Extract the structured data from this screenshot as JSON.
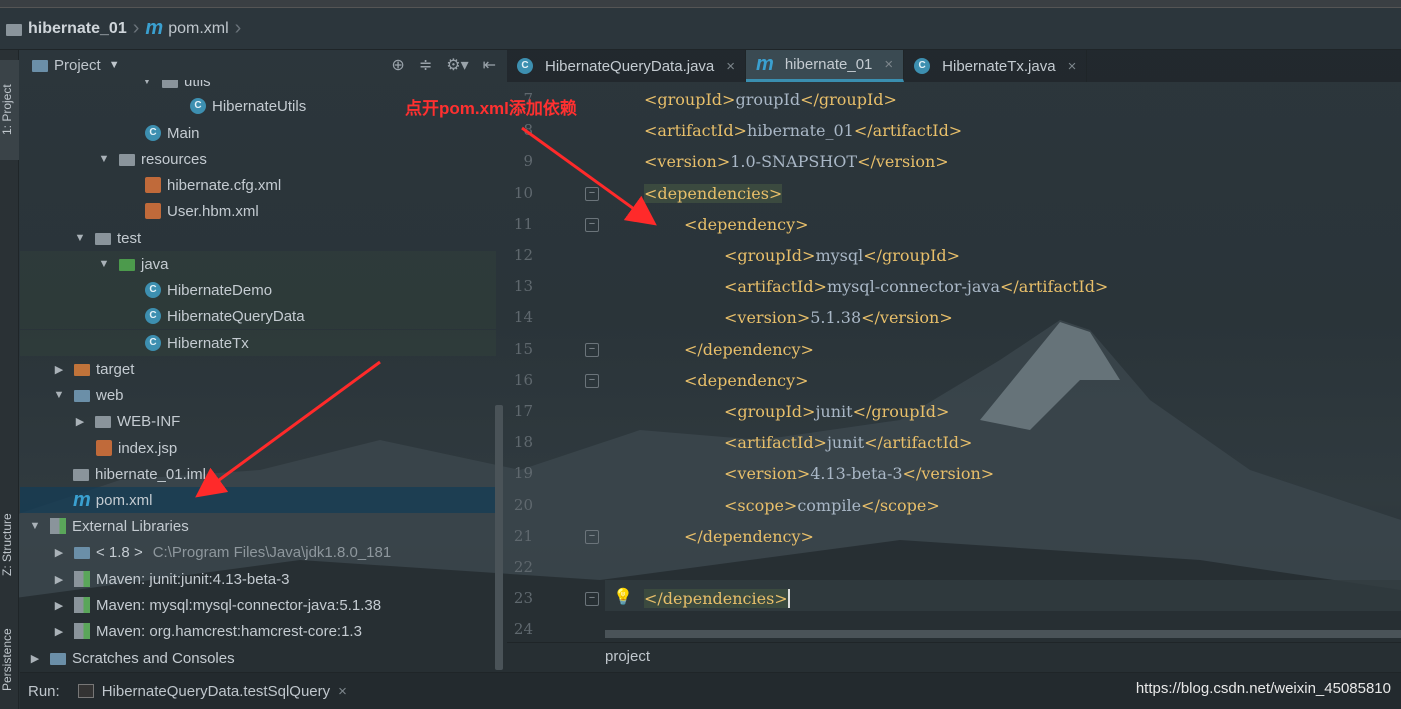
{
  "breadcrumb": {
    "project": "hibernate_01",
    "file": "pom.xml"
  },
  "left_strip": {
    "project": "1: Project",
    "structure": "Z: Structure",
    "persistence": "Persistence"
  },
  "project_panel": {
    "title": "Project",
    "tools": [
      "locate-icon",
      "collapse-icon",
      "gear-icon",
      "hide-icon"
    ]
  },
  "tree": [
    {
      "label": "utils",
      "type": "folder",
      "expanded": true
    },
    {
      "label": "HibernateUtils",
      "type": "class"
    },
    {
      "label": "Main",
      "type": "class"
    },
    {
      "label": "resources",
      "type": "folder",
      "expanded": true
    },
    {
      "label": "hibernate.cfg.xml",
      "type": "xml"
    },
    {
      "label": "User.hbm.xml",
      "type": "xml"
    },
    {
      "label": "test",
      "type": "folder",
      "expanded": true
    },
    {
      "label": "java",
      "type": "folder-green",
      "expanded": true
    },
    {
      "label": "HibernateDemo",
      "type": "class"
    },
    {
      "label": "HibernateQueryData",
      "type": "class"
    },
    {
      "label": "HibernateTx",
      "type": "class"
    },
    {
      "label": "target",
      "type": "folder-orange",
      "expanded": false
    },
    {
      "label": "web",
      "type": "folder-blue",
      "expanded": true
    },
    {
      "label": "WEB-INF",
      "type": "folder",
      "expanded": false
    },
    {
      "label": "index.jsp",
      "type": "jsp"
    },
    {
      "label": "hibernate_01.iml",
      "type": "iml"
    },
    {
      "label": "pom.xml",
      "type": "maven",
      "selected": true
    },
    {
      "label": "External Libraries",
      "type": "libs",
      "expanded": true
    },
    {
      "label": "< 1.8 >",
      "detail": "C:\\Program Files\\Java\\jdk1.8.0_181",
      "type": "jdk",
      "expanded": false
    },
    {
      "label": "Maven: junit:junit:4.13-beta-3",
      "type": "lib",
      "expanded": false
    },
    {
      "label": "Maven: mysql:mysql-connector-java:5.1.38",
      "type": "lib",
      "expanded": false
    },
    {
      "label": "Maven: org.hamcrest:hamcrest-core:1.3",
      "type": "lib",
      "expanded": false
    },
    {
      "label": "Scratches and Consoles",
      "type": "scratch",
      "expanded": false
    }
  ],
  "tabs": [
    {
      "label": "HibernateQueryData.java",
      "icon": "class"
    },
    {
      "label": "hibernate_01",
      "icon": "maven",
      "active": true
    },
    {
      "label": "HibernateTx.java",
      "icon": "class"
    }
  ],
  "code": [
    {
      "n": "7",
      "indent": 0,
      "tag": "groupId",
      "text": "groupId"
    },
    {
      "n": "8",
      "indent": 0,
      "tag": "artifactId",
      "text": "hibernate_01"
    },
    {
      "n": "9",
      "indent": 0,
      "tag": "version",
      "text": "1.0-SNAPSHOT"
    },
    {
      "n": "10",
      "indent": 0,
      "open": "dependencies"
    },
    {
      "n": "11",
      "indent": 1,
      "open": "dependency"
    },
    {
      "n": "12",
      "indent": 2,
      "tag": "groupId",
      "text": "mysql"
    },
    {
      "n": "13",
      "indent": 2,
      "tag": "artifactId",
      "text": "mysql-connector-java"
    },
    {
      "n": "14",
      "indent": 2,
      "tag": "version",
      "text": "5.1.38"
    },
    {
      "n": "15",
      "indent": 1,
      "close": "dependency"
    },
    {
      "n": "16",
      "indent": 1,
      "open": "dependency"
    },
    {
      "n": "17",
      "indent": 2,
      "tag": "groupId",
      "text": "junit"
    },
    {
      "n": "18",
      "indent": 2,
      "tag": "artifactId",
      "text": "junit"
    },
    {
      "n": "19",
      "indent": 2,
      "tag": "version",
      "text": "4.13-beta-3"
    },
    {
      "n": "20",
      "indent": 2,
      "tag": "scope",
      "text": "compile"
    },
    {
      "n": "21",
      "indent": 1,
      "close": "dependency"
    },
    {
      "n": "22",
      "indent": 0
    },
    {
      "n": "23",
      "indent": 0,
      "close": "dependencies"
    },
    {
      "n": "24",
      "indent": 0
    }
  ],
  "editor_status": "project",
  "run": {
    "label": "Run:",
    "config": "HibernateQueryData.testSqlQuery"
  },
  "annotation": "点开pom.xml添加依赖",
  "watermark": "https://blog.csdn.net/weixin_45085810",
  "colors": {
    "tag": "#e8bf6a",
    "text": "#a9b7c6",
    "annotation": "#ff3030",
    "selection": "#143c55"
  }
}
